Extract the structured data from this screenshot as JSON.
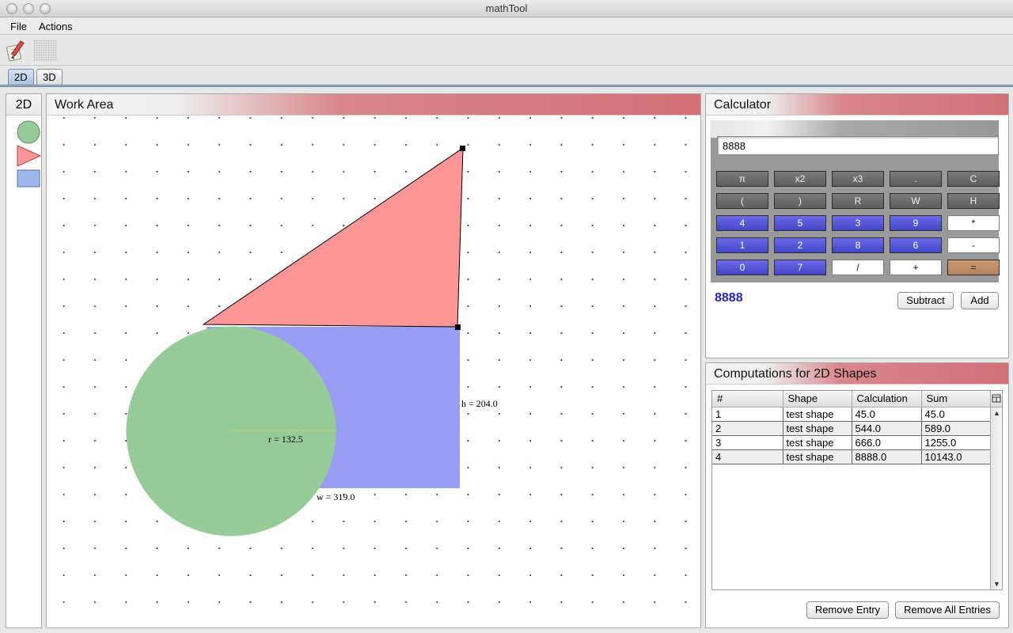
{
  "window": {
    "title": "mathTool"
  },
  "menu": [
    "File",
    "Actions"
  ],
  "tabs": [
    {
      "label": "2D",
      "active": true
    },
    {
      "label": "3D",
      "active": false
    }
  ],
  "shapes_panel": {
    "title": "2D"
  },
  "work_area": {
    "title": "Work Area",
    "labels": {
      "height": "h = 204.0",
      "width": "w = 319.0",
      "radius": "r = 132.5"
    },
    "colors": {
      "triangle": "#fe9597",
      "rectangle": "#9a9df4",
      "circle": "#98cb9a"
    }
  },
  "calculator": {
    "title": "Calculator",
    "input_value": "8888",
    "result": "8888",
    "keys": [
      [
        "π",
        "x2",
        "x3",
        ".",
        "C"
      ],
      [
        "(",
        ")",
        "R",
        "W",
        "H"
      ],
      [
        "4",
        "5",
        "3",
        "9",
        "*"
      ],
      [
        "1",
        "2",
        "8",
        "6",
        "-"
      ],
      [
        "0",
        "7",
        "/",
        "+",
        "="
      ]
    ],
    "subtract_label": "Subtract",
    "add_label": "Add"
  },
  "computations": {
    "title": "Computations for 2D Shapes",
    "columns": [
      "#",
      "Shape",
      "Calculation",
      "Sum"
    ],
    "rows": [
      [
        "1",
        "test shape",
        "45.0",
        "45.0"
      ],
      [
        "2",
        "test shape",
        "544.0",
        "589.0"
      ],
      [
        "3",
        "test shape",
        "666.0",
        "1255.0"
      ],
      [
        "4",
        "test shape",
        "8888.0",
        "10143.0"
      ]
    ],
    "remove_entry_label": "Remove Entry",
    "remove_all_label": "Remove All Entries"
  }
}
